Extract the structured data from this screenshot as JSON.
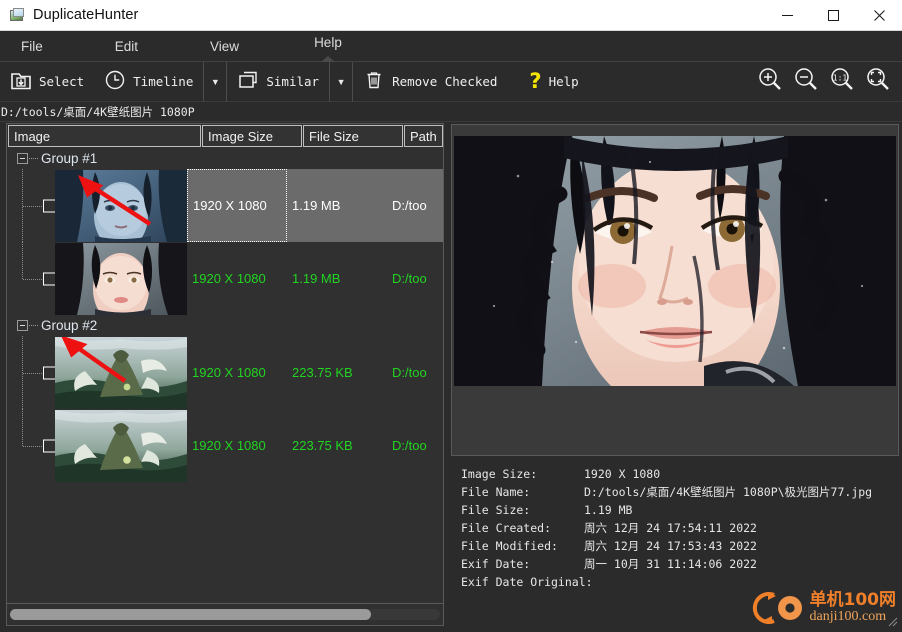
{
  "window": {
    "title": "DuplicateHunter",
    "icon": "image-app-icon",
    "controls": {
      "minimize": "–",
      "maximize": "□",
      "close": "✕"
    }
  },
  "menubar": {
    "items": [
      {
        "label": "File",
        "name": "menu-file"
      },
      {
        "label": "Edit",
        "name": "menu-edit"
      },
      {
        "label": "View",
        "name": "menu-view"
      },
      {
        "label": "Help",
        "name": "menu-help",
        "active": true
      }
    ]
  },
  "toolbar": {
    "select_label": "Select",
    "timeline_label": "Timeline",
    "similar_label": "Similar",
    "remove_checked_label": "Remove Checked",
    "help_label": "Help",
    "dropdown_glyph": "▼",
    "zoom_in": "zoom-in-icon",
    "zoom_out": "zoom-out-icon",
    "zoom_actual": "1:1",
    "zoom_fit": "zoom-fit-icon"
  },
  "pathbar": {
    "path": "D:/tools/桌面/4K壁纸图片 1080P"
  },
  "table": {
    "columns": [
      "Image",
      "Image Size",
      "File Size",
      "Path"
    ],
    "groups": [
      {
        "label": "Group #1",
        "items": [
          {
            "checked": false,
            "selected": true,
            "image_size": "1920 X 1080",
            "file_size": "1.19 MB",
            "path": "D:/too",
            "thumb": "portrait-blue",
            "has_arrow": true
          },
          {
            "checked": false,
            "selected": false,
            "image_size": "1920 X 1080",
            "file_size": "1.19 MB",
            "path": "D:/too",
            "thumb": "portrait-warm",
            "has_arrow": false
          }
        ]
      },
      {
        "label": "Group #2",
        "items": [
          {
            "checked": false,
            "selected": false,
            "image_size": "1920 X 1080",
            "file_size": "223.75 KB",
            "path": "D:/too",
            "thumb": "dragon-green",
            "has_arrow": true
          },
          {
            "checked": false,
            "selected": false,
            "image_size": "1920 X 1080",
            "file_size": "223.75 KB",
            "path": "D:/too",
            "thumb": "dragon-green",
            "has_arrow": false
          }
        ]
      }
    ]
  },
  "preview": {
    "alt": "portrait-warm-preview"
  },
  "metadata": {
    "rows": [
      {
        "key": "Image Size:",
        "value": "1920 X 1080"
      },
      {
        "key": "File Name:",
        "value": "D:/tools/桌面/4K壁纸图片 1080P\\极光图片77.jpg"
      },
      {
        "key": "File Size:",
        "value": "1.19 MB"
      },
      {
        "key": "File Created:",
        "value": "周六 12月 24 17:54:11 2022"
      },
      {
        "key": "File Modified:",
        "value": "周六 12月 24 17:53:43 2022"
      },
      {
        "key": "Exif Date:",
        "value": "周一 10月 31 11:14:06 2022"
      },
      {
        "key": "Exif Date Original:",
        "value": ""
      }
    ]
  },
  "watermark": {
    "cn": "单机100网",
    "en": "danji100.com"
  },
  "colors": {
    "window_bg": "#2b2b2b",
    "panel_bg": "#303030",
    "accent_green": "#21d421",
    "selection": "#6b6b6b",
    "help_yellow": "#f5e400",
    "watermark_orange": "#f07f2a"
  }
}
